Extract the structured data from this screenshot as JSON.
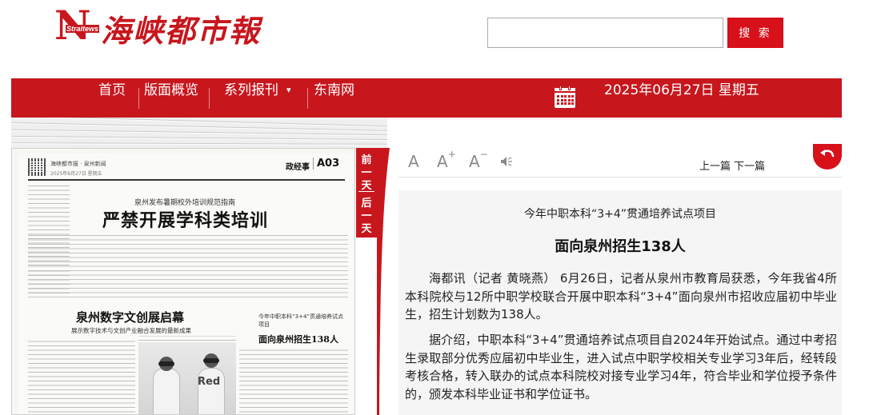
{
  "header": {
    "logo_brand": "Strait",
    "logo_letter": "N",
    "logo_suffix": "ews",
    "logo_title": "海峡都市報",
    "search_placeholder": "",
    "search_label": "搜 索"
  },
  "nav": {
    "items": [
      "首页",
      "版面概览",
      "系列报刊",
      "东南网"
    ],
    "date": "2025年06月27日 星期五",
    "bg_color": "#c8161d"
  },
  "paper": {
    "meta": "海峡都市报 · 泉州新闻",
    "meta2": "2025年6月27日  星期五",
    "section": "政经事",
    "page_no": "A03",
    "kicker1": "泉州发布暑期校外培训规范指南",
    "headline1": "严禁开展学科类培训",
    "headline2": "泉州数字文创展启幕",
    "subhead2": "展示数字技术与文创产业融合发展的最新成果",
    "kicker3": "今年中职本科“3+4”贯通培养试点项目",
    "headline3": "面向泉州招生138人",
    "photo_sign": "Red"
  },
  "vtab": {
    "prev": [
      "前",
      "一",
      "天"
    ],
    "next": [
      "后",
      "一",
      "天"
    ]
  },
  "toolbar": {
    "font_normal": "A",
    "font_plus": "A",
    "font_minus": "A",
    "plus_mark": "+",
    "minus_mark": "−",
    "prev_label": "上一篇",
    "next_label": "下一篇"
  },
  "article": {
    "kicker": "今年中职本科“3+4”贯通培养试点项目",
    "title": "面向泉州招生138人",
    "paragraphs": [
      "海都讯（记者 黄晓燕） 6月26日，记者从泉州市教育局获悉，今年我省4所本科院校与12所中职学校联合开展中职本科“3+4”面向泉州市招收应届初中毕业生，招生计划数为138人。",
      "据介绍，中职本科“3+4”贯通培养试点项目自2024年开始试点。通过中考招生录取部分优秀应届初中毕业生，进入试点中职学校相关专业学习3年后，经转段考核合格，转入联办的试点本科院校对接专业学习4年，符合毕业和学位授予条件的，颁发本科毕业证书和学位证书。"
    ]
  },
  "colors": {
    "brand_red": "#c8161d",
    "button_red": "#d7101a"
  }
}
